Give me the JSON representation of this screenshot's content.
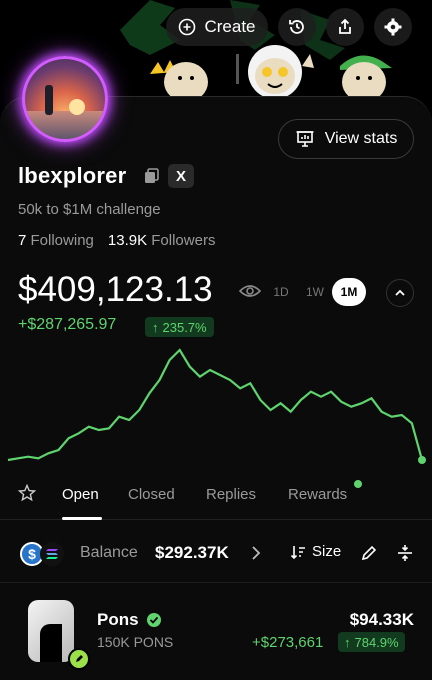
{
  "header": {
    "create_label": "Create"
  },
  "profile": {
    "username": "lbexplorer",
    "bio": "50k to $1M challenge",
    "following_count": "7",
    "following_label": "Following",
    "followers_count": "13.9K",
    "followers_label": "Followers",
    "view_stats_label": "View stats",
    "x_label": "X"
  },
  "portfolio": {
    "total_value": "$409,123.13",
    "pnl": "+$287,265.97",
    "pnl_pct": "235.7%",
    "range_options": [
      "1D",
      "1W",
      "1M"
    ],
    "range_selected": "1M"
  },
  "chart_data": {
    "type": "line",
    "y": [
      2.0,
      2.1,
      2.2,
      2.1,
      2.4,
      2.6,
      3.3,
      3.6,
      4.0,
      3.8,
      3.9,
      4.6,
      4.4,
      5.0,
      6.0,
      6.8,
      8.0,
      8.6,
      7.6,
      7.0,
      7.4,
      7.1,
      6.8,
      6.3,
      6.6,
      5.6,
      5.0,
      5.4,
      4.9,
      5.6,
      6.1,
      5.8,
      6.1,
      5.5,
      5.2,
      5.4,
      5.7,
      4.9,
      4.6,
      4.7,
      4.2,
      2.0
    ],
    "color": "#5fd46e"
  },
  "tabs": {
    "items": [
      "Open",
      "Closed",
      "Replies",
      "Rewards"
    ],
    "active": "Open"
  },
  "balance": {
    "label": "Balance",
    "value": "$292.37K",
    "sort_label": "Size"
  },
  "positions": [
    {
      "name": "Pons",
      "amount": "150K PONS",
      "value": "$94.33K",
      "pnl": "+$273,661",
      "pnl_pct": "784.9%"
    }
  ],
  "colors": {
    "accent_green": "#5fd46e",
    "avatar_ring": "#d25cff"
  }
}
